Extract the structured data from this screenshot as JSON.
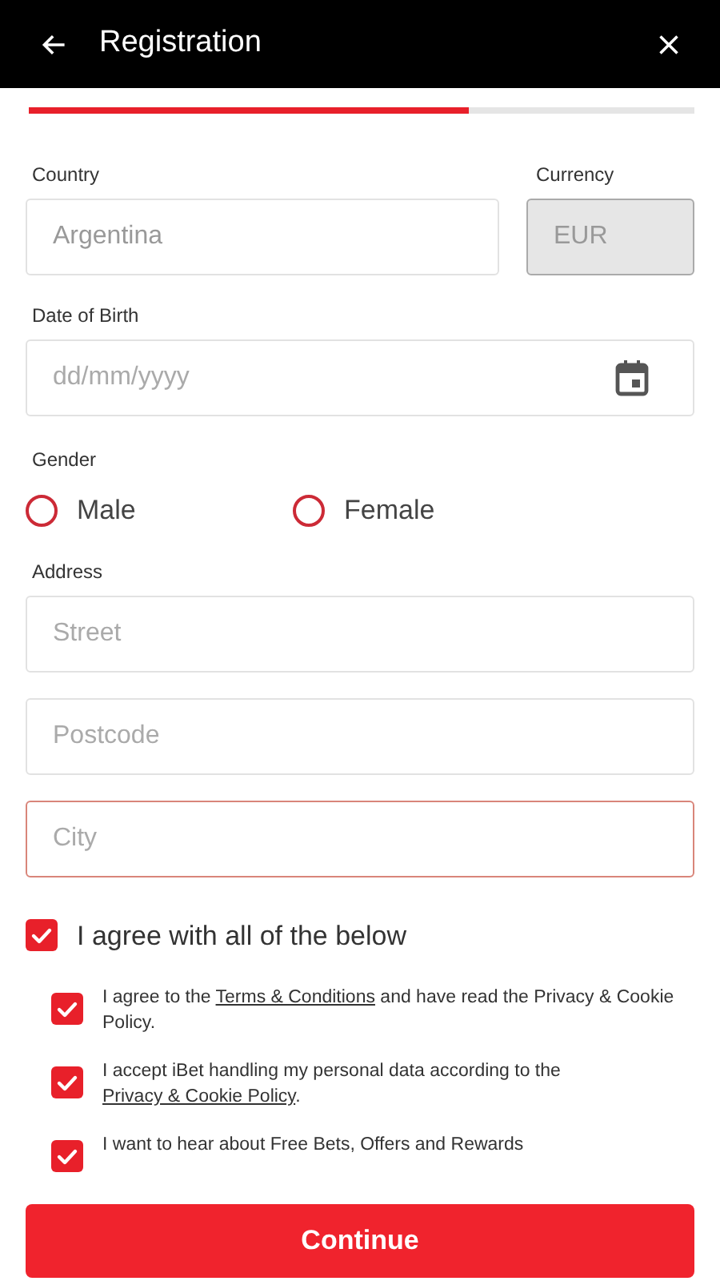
{
  "header": {
    "title": "Registration"
  },
  "progress": {
    "level": 0.66
  },
  "country": {
    "label": "Country",
    "value": "Argentina"
  },
  "currency": {
    "label": "Currency",
    "value": "EUR",
    "disabled": true
  },
  "date_of_birth": {
    "label": "Date of Birth",
    "placeholder": "dd/mm/yyyy"
  },
  "gender": {
    "label": "Gender",
    "options": [
      {
        "label": "Male",
        "selected": false
      },
      {
        "label": "Female",
        "selected": false
      }
    ]
  },
  "address": {
    "label": "Address",
    "fields": [
      {
        "placeholder": "Street",
        "invalid": false
      },
      {
        "placeholder": "Postcode",
        "invalid": false
      },
      {
        "placeholder": "City",
        "invalid": true
      }
    ]
  },
  "agree_all": {
    "label": "I agree with all of the below",
    "checked": true
  },
  "consents": [
    {
      "checked": true,
      "parts": [
        {
          "text": "I agree to the ",
          "link": false
        },
        {
          "text": "Terms & Conditions",
          "link": true
        },
        {
          "text": " and have read the Privacy & Cookie Policy.",
          "link": false
        }
      ]
    },
    {
      "checked": true,
      "parts": [
        {
          "text": "I accept iBet handling my personal data according to the ",
          "link": false
        },
        {
          "text": "Privacy & Cookie Policy",
          "link": true
        },
        {
          "text": ".",
          "link": false
        }
      ]
    },
    {
      "checked": true,
      "parts": [
        {
          "text": "I want to hear about Free Bets, Offers and Rewards",
          "link": false
        }
      ]
    }
  ],
  "continue_button": {
    "label": "Continue"
  }
}
